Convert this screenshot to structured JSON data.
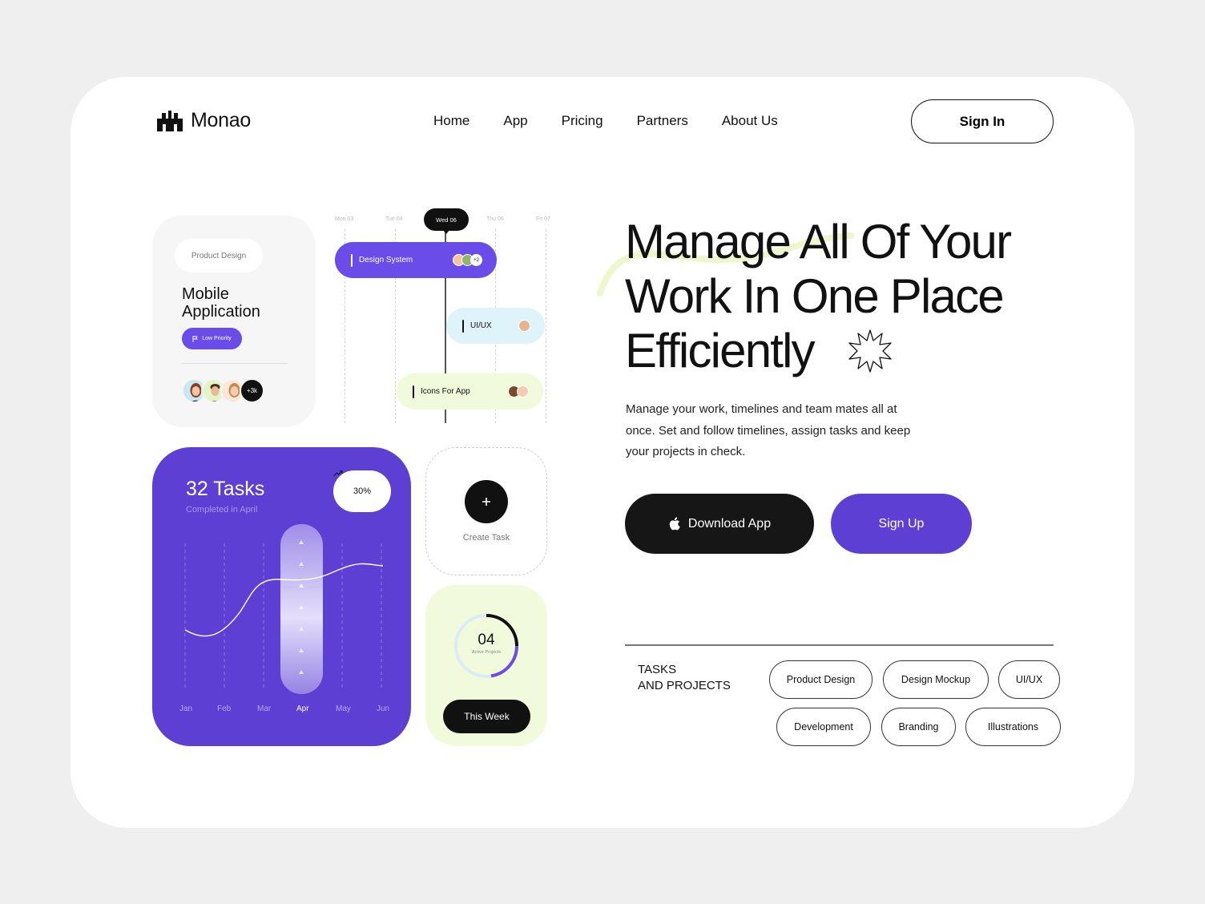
{
  "header": {
    "brand": "Monao",
    "nav": [
      "Home",
      "App",
      "Pricing",
      "Partners",
      "About Us"
    ],
    "signin_label": "Sign In"
  },
  "project_card": {
    "category": "Product Design",
    "title": "Mobile Application",
    "priority": "Low Priority",
    "more_members": "+3k"
  },
  "timeline": {
    "days": [
      "Mon 03",
      "Tue 04",
      "Wed 06",
      "Thu 06",
      "Fri 07"
    ],
    "current_day": "Wed 06",
    "tasks": [
      {
        "label": "Design System",
        "extra": "+2"
      },
      {
        "label": "UI/UX"
      },
      {
        "label": "Icons For App"
      }
    ]
  },
  "tasks_card": {
    "title": "32 Tasks",
    "subtitle": "Completed in April",
    "change": "30%",
    "months": [
      "Jan",
      "Feb",
      "Mar",
      "Apr",
      "May",
      "Jun"
    ],
    "highlight": "Apr"
  },
  "create_task": {
    "label": "Create Task",
    "icon": "plus-icon"
  },
  "active_projects": {
    "value": "04",
    "label": "Active Projects",
    "progress": 0.4,
    "button": "This Week"
  },
  "hero": {
    "title_lines": [
      "Manage All Of Your",
      "Work In One Place",
      "Efficiently"
    ],
    "description": "Manage your work, timelines and team mates all at once. Set and follow timelines, assign tasks and keep your projects in check.",
    "download_label": "Download App",
    "signup_label": "Sign Up"
  },
  "tags": {
    "heading_line1": "TASKS",
    "heading_line2": "AND PROJECTS",
    "items": [
      "Product Design",
      "Design Mockup",
      "UI/UX",
      "Development",
      "Branding",
      "Illustrations"
    ]
  },
  "colors": {
    "purple": "#5d3fd3",
    "purple_light": "#6a4ce8",
    "lime": "#f1fbdc",
    "sky": "#dff3fb",
    "dark": "#111111"
  }
}
